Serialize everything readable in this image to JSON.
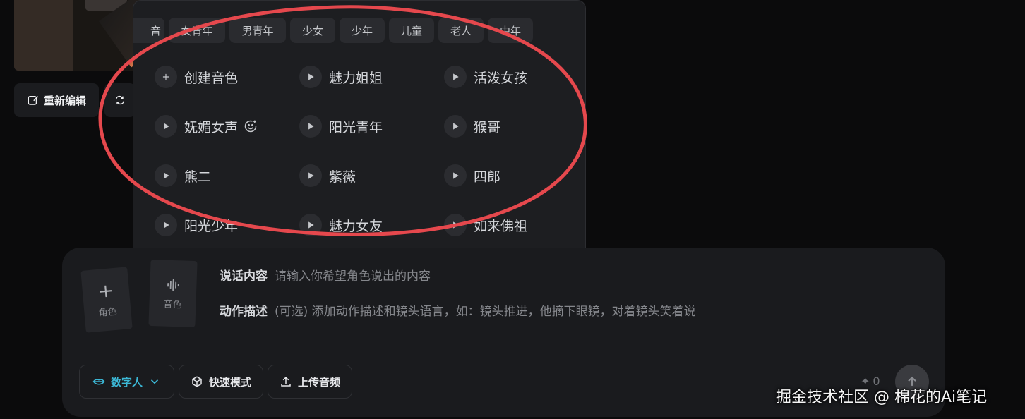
{
  "image_actions": {
    "reedit_label": "重新编辑"
  },
  "voice_panel": {
    "chips": [
      "音",
      "女青年",
      "男青年",
      "少女",
      "少年",
      "儿童",
      "老人",
      "中年"
    ],
    "voices": [
      {
        "label": "创建音色",
        "icon": "plus-icon"
      },
      {
        "label": "魅力姐姐",
        "icon": "play-icon"
      },
      {
        "label": "活泼女孩",
        "icon": "play-icon"
      },
      {
        "label": "妩媚女声",
        "icon": "play-icon",
        "badge": "smile-icon"
      },
      {
        "label": "阳光青年",
        "icon": "play-icon"
      },
      {
        "label": "猴哥",
        "icon": "play-icon"
      },
      {
        "label": "熊二",
        "icon": "play-icon"
      },
      {
        "label": "紫薇",
        "icon": "play-icon"
      },
      {
        "label": "四郎",
        "icon": "play-icon"
      },
      {
        "label": "阳光少年",
        "icon": "play-icon"
      },
      {
        "label": "魅力女友",
        "icon": "play-icon"
      },
      {
        "label": "如来佛祖",
        "icon": "play-icon"
      }
    ]
  },
  "composer": {
    "role_card_label": "角色",
    "voice_card_label": "音色",
    "speech_label": "说话内容",
    "speech_placeholder": "请输入你希望角色说出的内容",
    "action_label": "动作描述",
    "action_placeholder": "(可选) 添加动作描述和镜头语言，如：镜头推进，他摘下眼镜，对着镜头笑着说",
    "mode_digital": "数字人",
    "mode_fast": "快速模式",
    "upload_audio": "上传音频",
    "credits": "0"
  },
  "watermark": "掘金技术社区 @ 棉花的Ai笔记",
  "colors": {
    "background": "#0b0b0c",
    "panel": "#1d1e21",
    "accent_cyan": "#3cb8d6",
    "annotation_red": "#e5484d"
  }
}
